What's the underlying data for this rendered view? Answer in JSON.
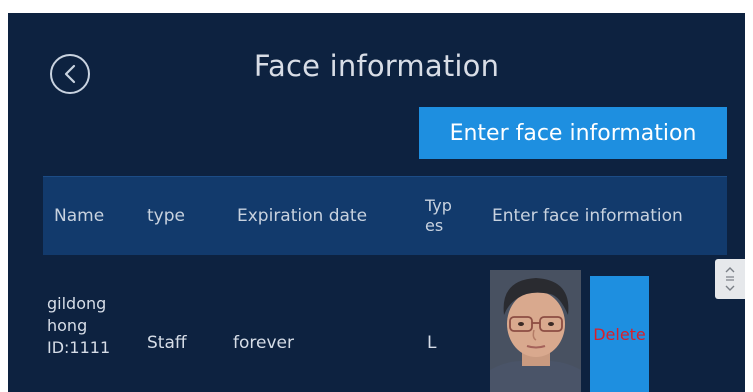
{
  "header": {
    "title": "Face information",
    "back_icon": "chevron-left-circle-icon"
  },
  "actions": {
    "enter_face_label": "Enter face information"
  },
  "table": {
    "columns": [
      "Name",
      "type",
      "Expiration date",
      "Types",
      "Enter face information"
    ],
    "rows": [
      {
        "name_line1": "gildong",
        "name_line2": "hong",
        "id": "ID:1111",
        "type": "Staff",
        "expiration": "forever",
        "types": "L",
        "delete_label": "Delete"
      }
    ]
  },
  "colors": {
    "background": "#0d2240",
    "header_row": "#123a6c",
    "button": "#1e8fe0",
    "delete_text": "#d8202a"
  }
}
